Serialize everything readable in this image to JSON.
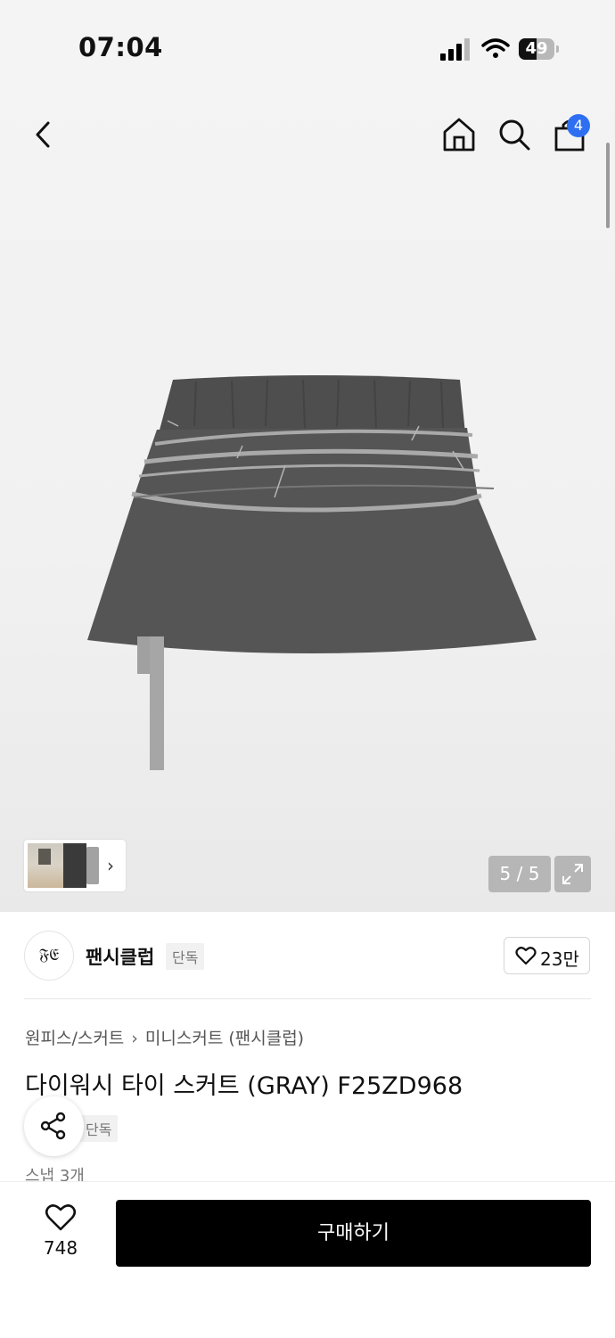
{
  "status_bar": {
    "time": "07:04",
    "battery": "49",
    "battery_level": 0.49
  },
  "header": {
    "cart_count": "4",
    "icons": [
      "back-icon",
      "home-icon",
      "search-icon",
      "bag-icon"
    ]
  },
  "gallery": {
    "counter": "5 / 5",
    "current": 5,
    "total": 5,
    "product_color": "#555555",
    "stripe_color": "#a9a9a9"
  },
  "brand": {
    "logo_text": "𝔉𝔈",
    "name": "팬시클럽",
    "tag": "단독",
    "likes": "23만"
  },
  "breadcrumb": {
    "category": "원피스/스커트",
    "subcategory": "미니스커트 (팬시클럽)"
  },
  "product": {
    "title": "다이워시 타이 스커트 (GRAY) F25ZD968",
    "tag": "단독",
    "snap": "스냅 3개"
  },
  "bottom": {
    "wish_count": "748",
    "buy_label": "구매하기"
  },
  "colors": {
    "badge": "#2e6ff2",
    "buy_button": "#000000"
  }
}
